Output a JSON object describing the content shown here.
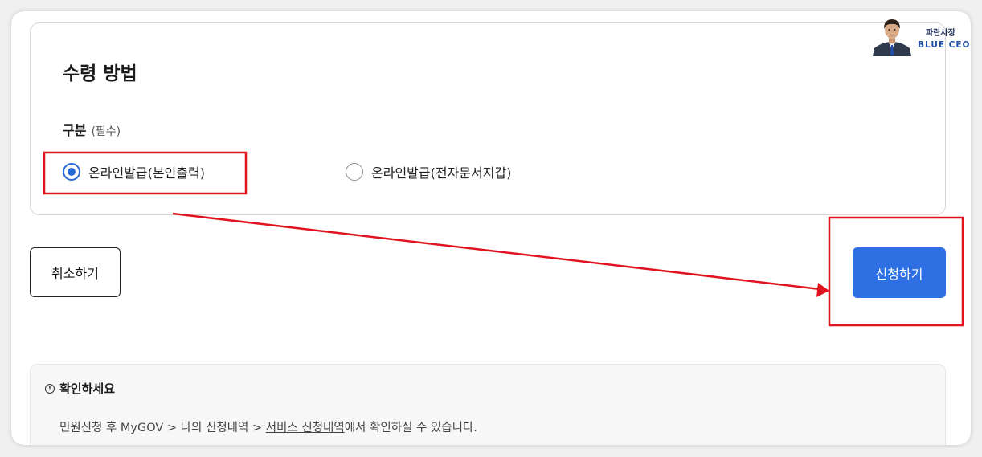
{
  "section": {
    "title": "수령 방법"
  },
  "field": {
    "label": "구분",
    "required_note": "(필수)"
  },
  "options": [
    {
      "label": "온라인발급(본인출력)",
      "selected": true
    },
    {
      "label": "온라인발급(전자문서지갑)",
      "selected": false
    }
  ],
  "buttons": {
    "cancel": "취소하기",
    "submit": "신청하기"
  },
  "notice": {
    "icon": "!",
    "title": "확인하세요",
    "text_before": "민원신청 후 MyGOV > 나의 신청내역 > ",
    "link": "서비스 신청내역",
    "text_after": "에서 확인하실 수 있습니다."
  },
  "brand": {
    "name_kr": "파란사장",
    "name_en": "BLUE CEO"
  },
  "colors": {
    "accent": "#2f6fe4",
    "annotation": "#e0141e",
    "radio_checked": "#2a6bd8"
  }
}
